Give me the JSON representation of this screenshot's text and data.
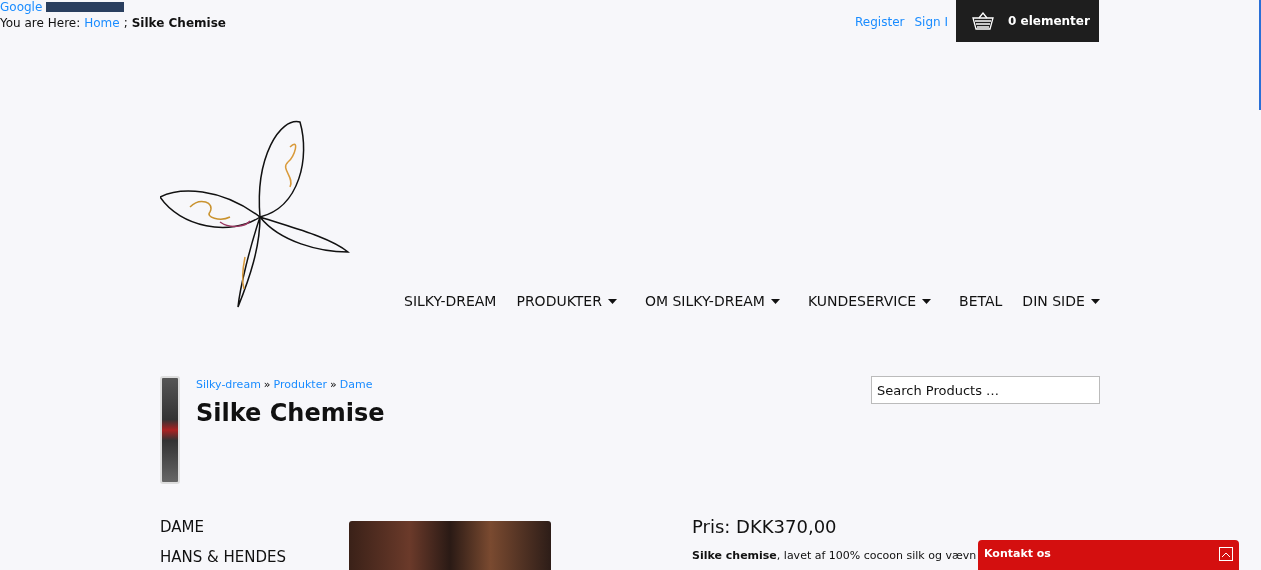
{
  "top_links": {
    "google": "Google",
    "breadcrumb_label": "You are Here:",
    "breadcrumb_home": "Home",
    "breadcrumb_separator": ";",
    "breadcrumb_current": "Silke Chemise"
  },
  "account_links": [
    "Register",
    "Sign I"
  ],
  "cart": {
    "label": "0 elementer"
  },
  "nav": [
    {
      "label": "SILKY-DREAM",
      "has_dropdown": false
    },
    {
      "label": "PRODUKTER",
      "has_dropdown": true
    },
    {
      "label": "OM SILKY-DREAM",
      "has_dropdown": true
    },
    {
      "label": "KUNDESERVICE",
      "has_dropdown": true
    },
    {
      "label": "BETAL",
      "has_dropdown": false
    },
    {
      "label": "DIN SIDE",
      "has_dropdown": true
    }
  ],
  "product_breadcrumb": [
    "Silky-dream",
    "Produkter",
    "Dame"
  ],
  "product_breadcrumb_separator": "»",
  "title": "Silke Chemise",
  "search": {
    "placeholder": "Search Products …"
  },
  "categories": [
    "DAME",
    "HANS & HENDES"
  ],
  "price": "Pris: DKK370,00",
  "description": "**Silke chemise**, lavet af 100% cocoon silk og vævn",
  "contact_widget": {
    "title": "Kontakt os"
  }
}
